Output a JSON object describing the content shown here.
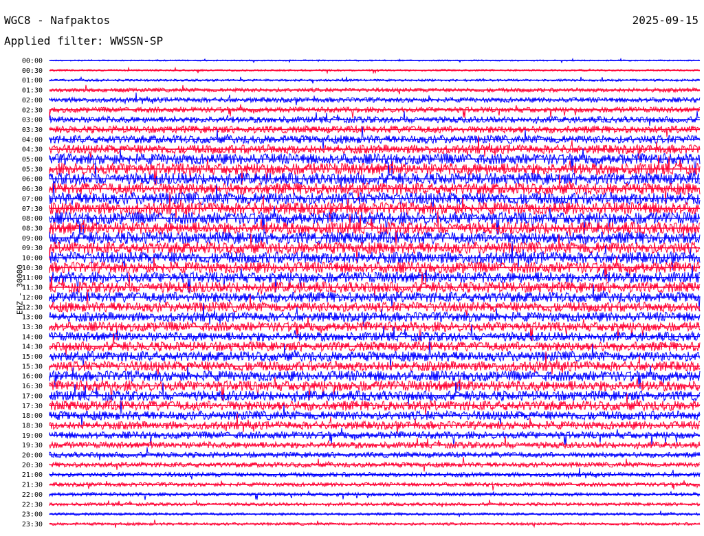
{
  "header": {
    "station": "WGC8 - Nafpaktos",
    "date": "2025-09-15",
    "filter": "Applied filter: WWSSN-SP",
    "channel": "EHZ - 30000"
  },
  "colors": {
    "odd": "#0000ff",
    "even": "#ff0033",
    "background": "#ffffff"
  },
  "chart_data": {
    "type": "line",
    "title": "WGC8 - Nafpaktos",
    "xlabel": "",
    "ylabel": "EHZ - 30000",
    "rows": [
      "00:00",
      "00:30",
      "01:00",
      "01:30",
      "02:00",
      "02:30",
      "03:00",
      "03:30",
      "04:00",
      "04:30",
      "05:00",
      "05:30",
      "06:00",
      "06:30",
      "07:00",
      "07:30",
      "08:00",
      "08:30",
      "09:00",
      "09:30",
      "10:00",
      "10:30",
      "11:00",
      "11:30",
      "12:00",
      "12:30",
      "13:00",
      "13:30",
      "14:00",
      "14:30",
      "15:00",
      "15:30",
      "16:00",
      "16:30",
      "17:00",
      "17:30",
      "18:00",
      "18:30",
      "19:00",
      "19:30",
      "20:00",
      "20:30",
      "21:00",
      "21:30",
      "22:00",
      "22:30",
      "23:00",
      "23:30"
    ],
    "noise_level": [
      0.15,
      0.2,
      0.25,
      0.45,
      0.55,
      0.6,
      0.7,
      0.8,
      0.9,
      1.0,
      1.2,
      1.3,
      1.3,
      1.3,
      1.35,
      1.35,
      1.35,
      1.35,
      1.35,
      1.3,
      1.3,
      1.25,
      1.2,
      1.2,
      1.15,
      1.1,
      1.05,
      1.05,
      1.0,
      1.05,
      1.1,
      1.1,
      1.15,
      1.15,
      1.1,
      1.1,
      1.0,
      0.9,
      0.8,
      0.7,
      0.6,
      0.55,
      0.5,
      0.45,
      0.4,
      0.35,
      0.3,
      0.3
    ]
  }
}
